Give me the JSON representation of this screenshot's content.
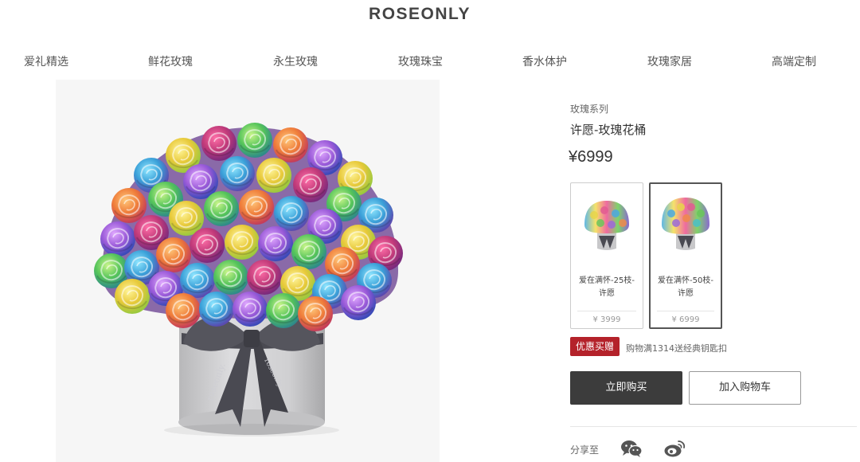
{
  "brand": {
    "logo": "ROSEONLY"
  },
  "nav": {
    "items": [
      {
        "label": "爱礼精选"
      },
      {
        "label": "鲜花玫瑰"
      },
      {
        "label": "永生玫瑰"
      },
      {
        "label": "玫瑰珠宝"
      },
      {
        "label": "香水体护"
      },
      {
        "label": "玫瑰家居"
      },
      {
        "label": "高端定制"
      }
    ]
  },
  "product": {
    "series": "玫瑰系列",
    "title": "许愿-玫瑰花桶",
    "price": "¥6999",
    "image_box_text": [
      "roseonly",
      "trust",
      "roseonly",
      "trust",
      "roseonly."
    ],
    "options": [
      {
        "name_line1": "爱在满怀-25枝-",
        "name_line2": "许愿",
        "price": "¥ 3999",
        "selected": false
      },
      {
        "name_line1": "爱在满怀-50枝-",
        "name_line2": "许愿",
        "price": "¥ 6999",
        "selected": true
      }
    ]
  },
  "promo": {
    "tag": "优惠买赠",
    "text": "购物满1314送经典钥匙扣"
  },
  "actions": {
    "buy_label": "立即购买",
    "cart_label": "加入购物车"
  },
  "share": {
    "label": "分享至",
    "icons": [
      "wechat-icon",
      "weibo-icon"
    ]
  },
  "colors": {
    "promo_red": "#b4222a",
    "buy_button": "#3c3c3c",
    "ribbon": "#4a4a52",
    "box": "#d4d4d6"
  }
}
